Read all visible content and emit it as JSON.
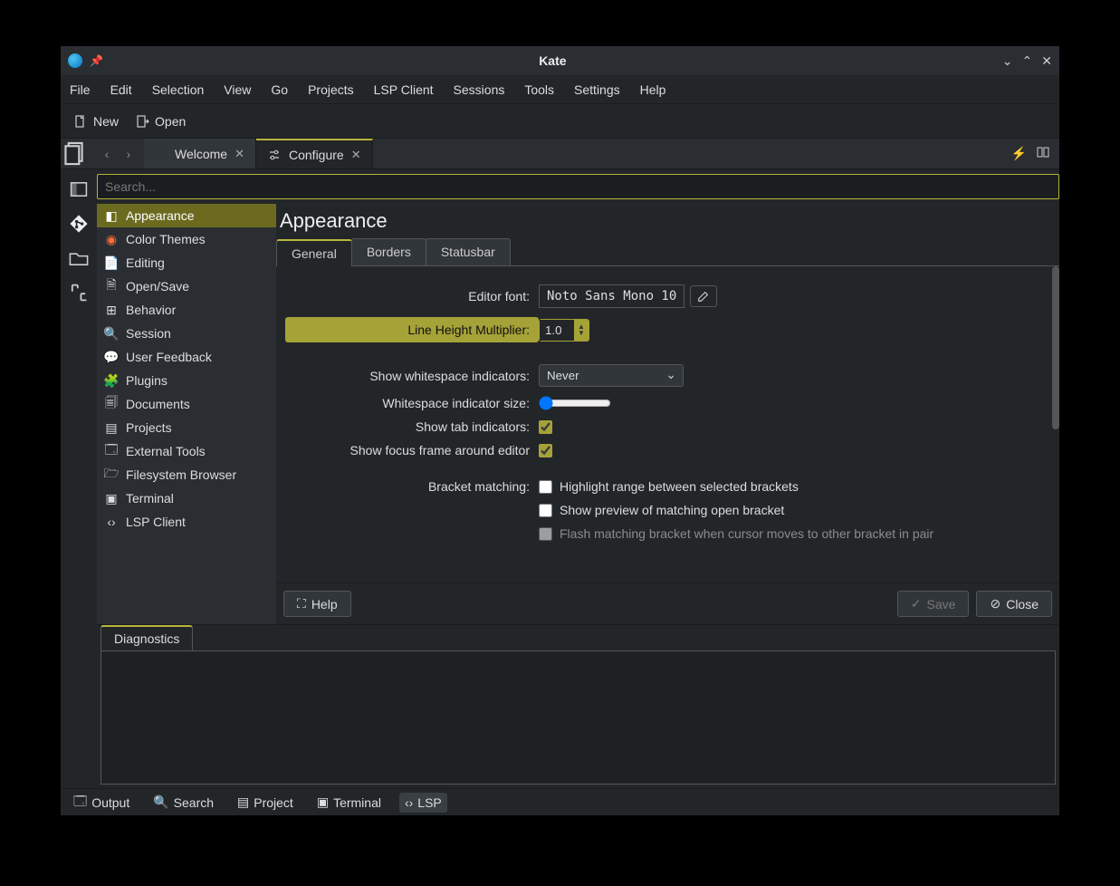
{
  "title": "Kate",
  "menubar": [
    "File",
    "Edit",
    "Selection",
    "View",
    "Go",
    "Projects",
    "LSP Client",
    "Sessions",
    "Tools",
    "Settings",
    "Help"
  ],
  "toolbar": {
    "new": "New",
    "open": "Open"
  },
  "tabs": [
    {
      "label": "Welcome",
      "active": false
    },
    {
      "label": "Configure",
      "active": true
    }
  ],
  "search_placeholder": "Search...",
  "sidebar": [
    "Appearance",
    "Color Themes",
    "Editing",
    "Open/Save",
    "Behavior",
    "Session",
    "User Feedback",
    "Plugins",
    "Documents",
    "Projects",
    "External Tools",
    "Filesystem Browser",
    "Terminal",
    "LSP Client"
  ],
  "page_title": "Appearance",
  "subtabs": [
    "General",
    "Borders",
    "Statusbar"
  ],
  "form": {
    "editor_font_label": "Editor font:",
    "editor_font_value": "Noto Sans Mono 10",
    "line_height_label": "Line Height Multiplier:",
    "line_height_value": "1.0",
    "whitespace_label": "Show whitespace indicators:",
    "whitespace_value": "Never",
    "whitespace_size_label": "Whitespace indicator size:",
    "tab_indicators_label": "Show tab indicators:",
    "focus_frame_label": "Show focus frame around editor",
    "bracket_label": "Bracket matching:",
    "bracket_opt1": "Highlight range between selected brackets",
    "bracket_opt2": "Show preview of matching open bracket",
    "bracket_opt3": "Flash matching bracket when cursor moves to other bracket in pair"
  },
  "buttons": {
    "help": "Help",
    "save": "Save",
    "close": "Close"
  },
  "diagnostics_tab": "Diagnostics",
  "statusbar": {
    "output": "Output",
    "search": "Search",
    "project": "Project",
    "terminal": "Terminal",
    "lsp": "LSP"
  }
}
